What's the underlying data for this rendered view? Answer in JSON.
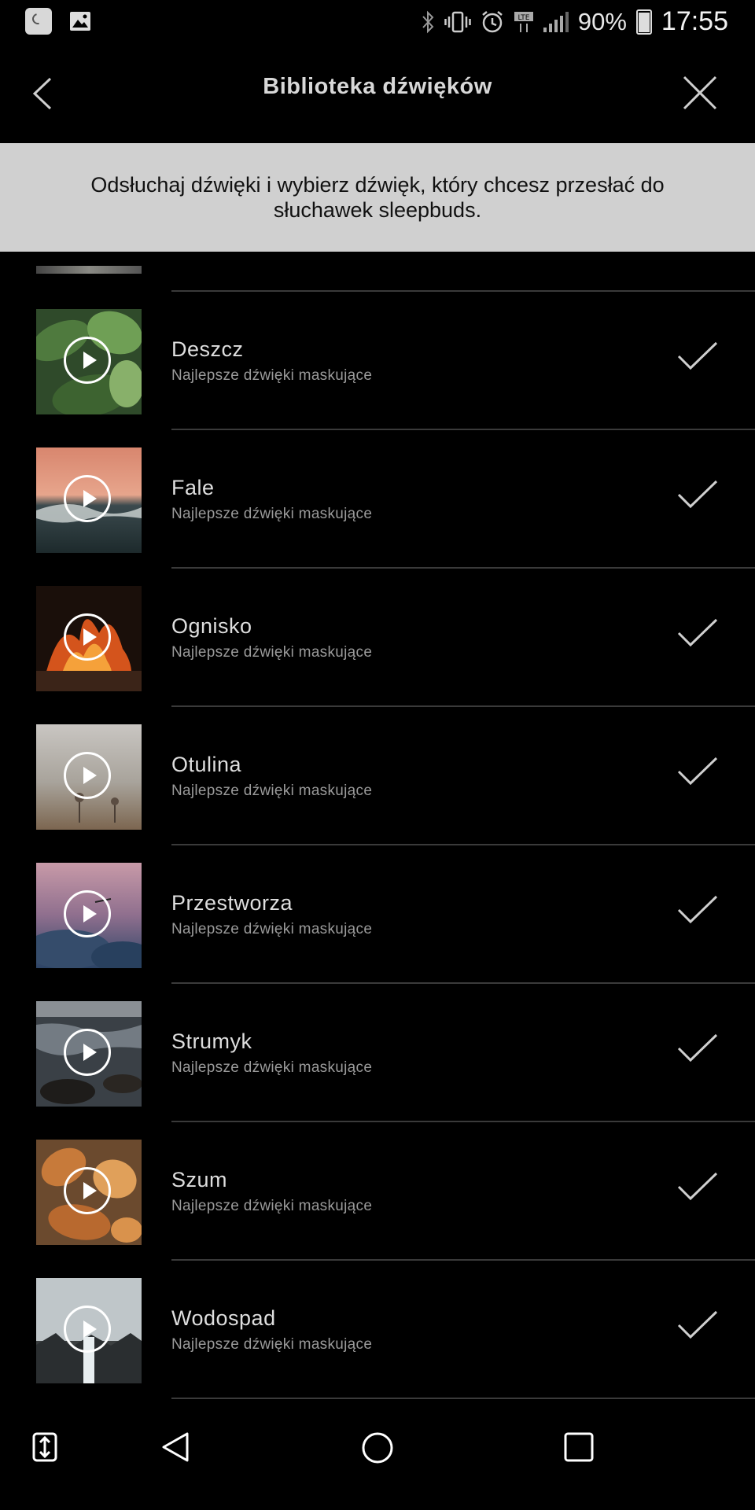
{
  "status_bar": {
    "left_icons": [
      "sleep-notification-icon",
      "gallery-icon"
    ],
    "right_icons": [
      "bluetooth-icon",
      "vibrate-icon",
      "alarm-icon",
      "lte-icon",
      "signal-icon"
    ],
    "battery": "90%",
    "time": "17:55"
  },
  "header": {
    "title": "Biblioteka dźwięków",
    "back_icon": "chevron-left-icon",
    "close_icon": "close-icon"
  },
  "banner": {
    "text": "Odsłuchaj dźwięki i wybierz dźwięk, który chcesz przesłać do słuchawek sleepbuds."
  },
  "sounds": [
    {
      "name": "Deszcz",
      "subtitle": "Najlepsze dźwięki maskujące",
      "selected": true
    },
    {
      "name": "Fale",
      "subtitle": "Najlepsze dźwięki maskujące",
      "selected": true
    },
    {
      "name": "Ognisko",
      "subtitle": "Najlepsze dźwięki maskujące",
      "selected": true
    },
    {
      "name": "Otulina",
      "subtitle": "Najlepsze dźwięki maskujące",
      "selected": true
    },
    {
      "name": "Przestworza",
      "subtitle": "Najlepsze dźwięki maskujące",
      "selected": true
    },
    {
      "name": "Strumyk",
      "subtitle": "Najlepsze dźwięki maskujące",
      "selected": true
    },
    {
      "name": "Szum",
      "subtitle": "Najlepsze dźwięki maskujące",
      "selected": true
    },
    {
      "name": "Wodospad",
      "subtitle": "Najlepsze dźwięki maskujące",
      "selected": true
    }
  ],
  "nav_bar": {
    "buttons": [
      "swap-icon",
      "back-triangle-icon",
      "home-circle-icon",
      "recents-square-icon"
    ]
  },
  "colors": {
    "background": "#000000",
    "banner_bg": "#d0d0d0",
    "divider": "#3a3a3a"
  }
}
